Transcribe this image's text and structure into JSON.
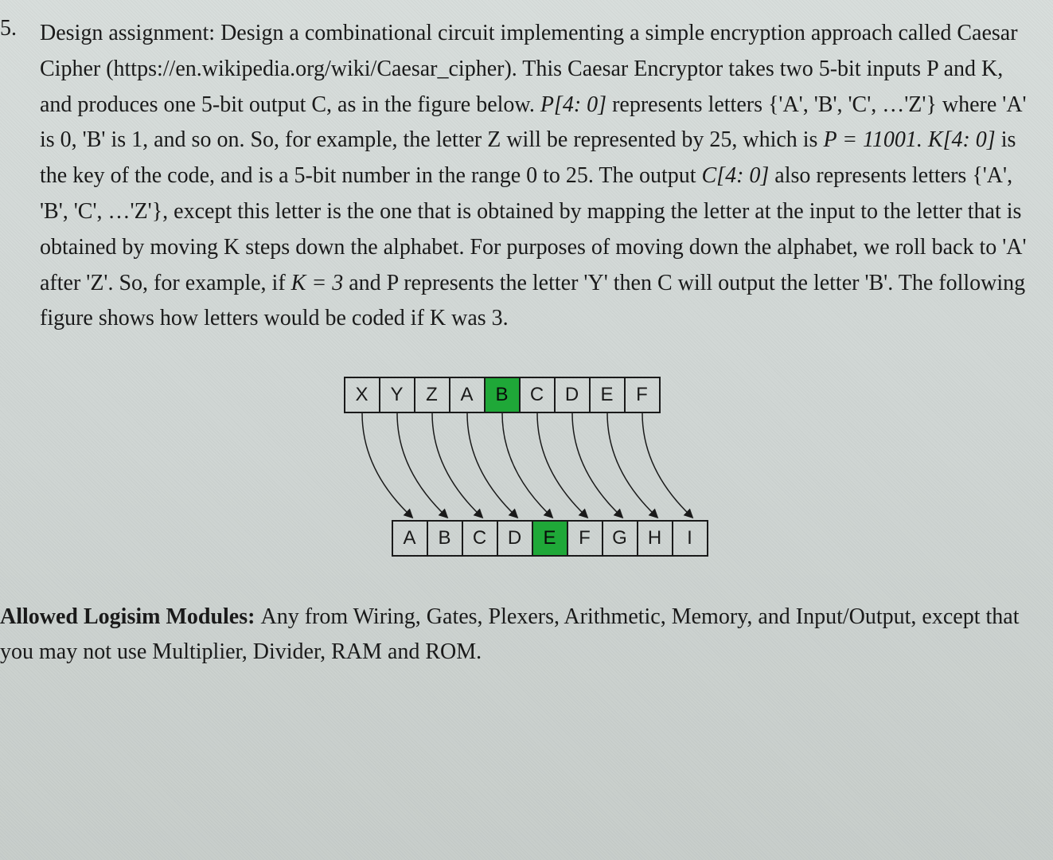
{
  "problem": {
    "number": "5.",
    "text_part1": "Design assignment: Design a combinational circuit implementing a simple encryption approach called Caesar Cipher (https://en.wikipedia.org/wiki/Caesar_cipher). This Caesar Encryptor takes two 5-bit inputs P and K, and produces one 5-bit output C, as in the figure below. ",
    "p_notation": "P[4: 0]",
    "text_part2": " represents letters {'A', 'B', 'C', …'Z'} where 'A' is 0, 'B' is 1, and so on. So, for example, the letter Z will be represented by 25, which is ",
    "p_equation": "P = 11001. ",
    "k_notation": "K[4: 0]",
    "text_part3": " is the key of the code, and is a 5-bit number in the range 0 to 25. The output ",
    "c_notation": "C[4: 0]",
    "text_part4": " also represents letters {'A', 'B', 'C', …'Z'}, except this letter is the one that is obtained by mapping the letter at the input to the letter that is obtained by moving K steps down the alphabet. For purposes of moving down the alphabet, we roll back to 'A' after 'Z'. So, for example, if ",
    "k_equation": "K = 3",
    "text_part5": " and P represents the letter 'Y' then C will output the letter 'B'. The following figure shows how letters would be coded if K was 3."
  },
  "diagram": {
    "top_row": [
      "X",
      "Y",
      "Z",
      "A",
      "B",
      "C",
      "D",
      "E",
      "F"
    ],
    "top_highlighted_index": 4,
    "bottom_row": [
      "A",
      "B",
      "C",
      "D",
      "E",
      "F",
      "G",
      "H",
      "I"
    ],
    "bottom_highlighted_index": 4
  },
  "allowed": {
    "label": "Allowed Logisim Modules: ",
    "text": "Any from Wiring, Gates, Plexers, Arithmetic, Memory, and Input/Output, except that you may not use Multiplier, Divider, RAM and ROM."
  }
}
